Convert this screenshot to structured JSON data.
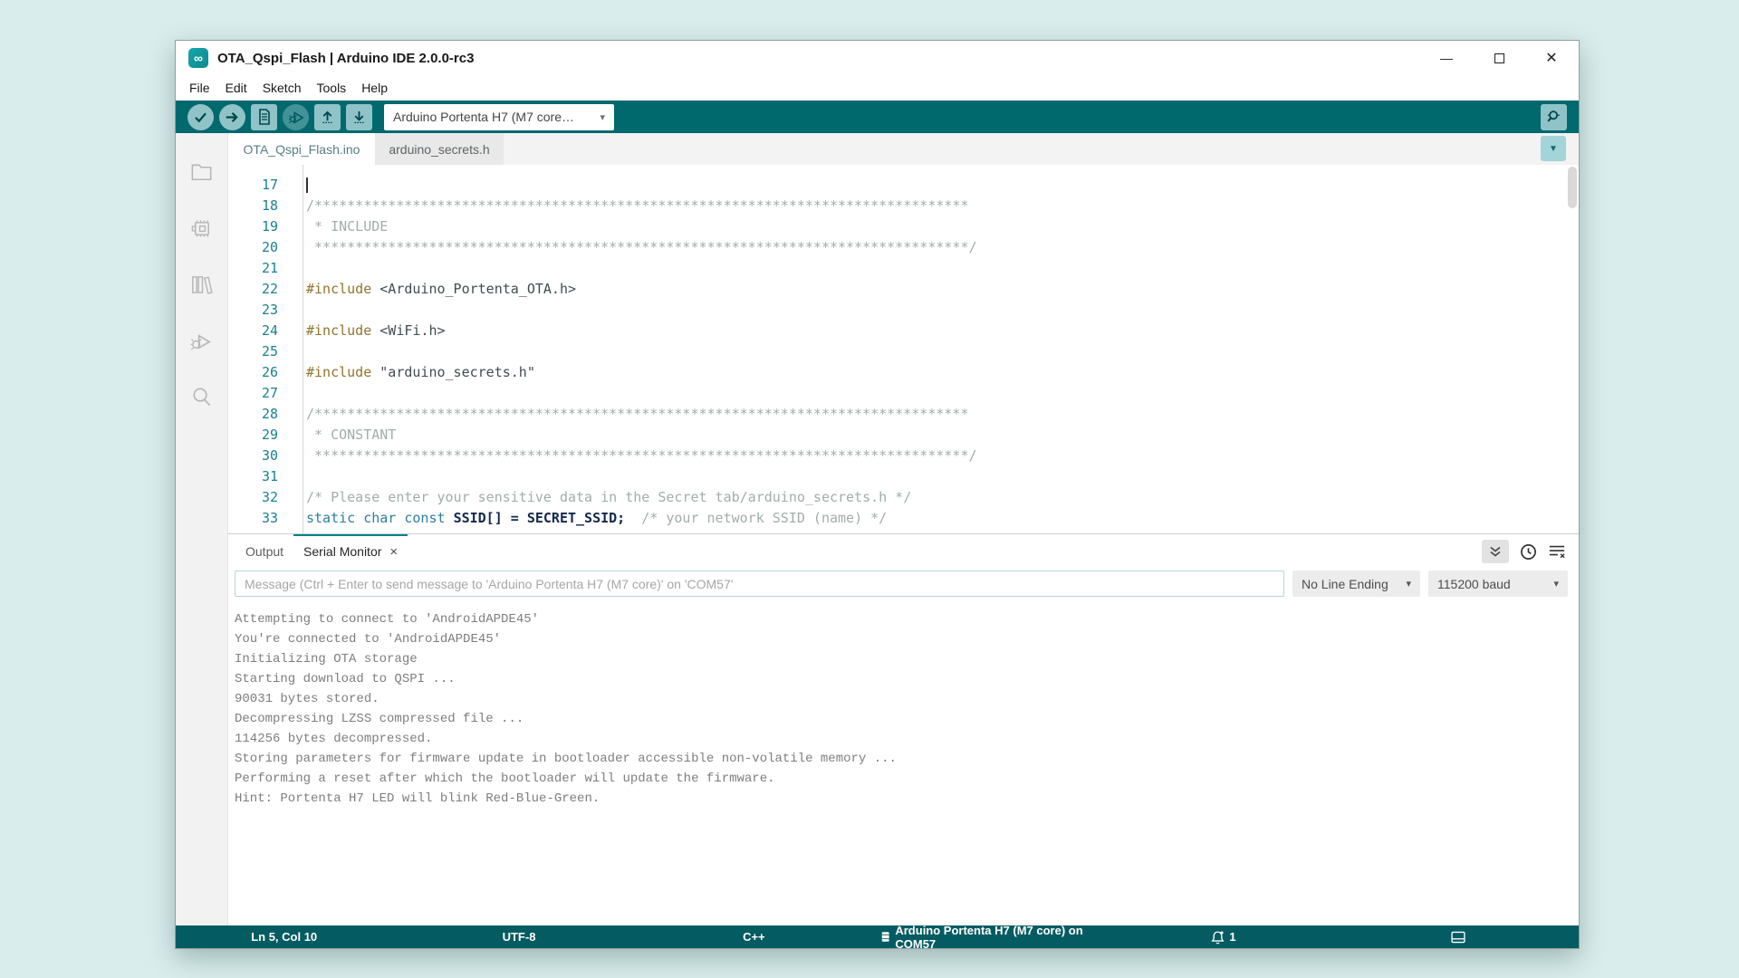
{
  "window": {
    "title": "OTA_Qspi_Flash | Arduino IDE 2.0.0-rc3"
  },
  "menu": {
    "items": [
      "File",
      "Edit",
      "Sketch",
      "Tools",
      "Help"
    ]
  },
  "toolbar": {
    "board_selector": "Arduino Portenta H7 (M7 core…"
  },
  "icons": {
    "toolbar": [
      "check",
      "arrow-right",
      "document",
      "bug-play",
      "arrow-up",
      "arrow-down",
      "caret-down",
      "magnifier"
    ],
    "sidebar": [
      "folder",
      "board-chip",
      "library-books",
      "debug-bug",
      "search-magnifier"
    ],
    "panel": [
      "collapse-double-chevron",
      "timestamp-clock",
      "clear-output"
    ],
    "status": [
      "board-chip",
      "notification-bell",
      "toggle-panel"
    ]
  },
  "colors": {
    "toolbar_teal": "#00696e",
    "status_teal": "#045c62",
    "button_teal": "#8fc3c7",
    "accent_teal": "#00838a",
    "page_background": "#d9edec"
  },
  "editor": {
    "tabs": [
      {
        "label": "OTA_Qspi_Flash.ino",
        "active": true
      },
      {
        "label": "arduino_secrets.h",
        "active": false
      }
    ],
    "lines": [
      {
        "n": 17,
        "cursor": true,
        "tokens": []
      },
      {
        "n": 18,
        "tokens": [
          {
            "t": "/********************************************************************************",
            "c": "comment"
          }
        ]
      },
      {
        "n": 19,
        "tokens": [
          {
            "t": " * INCLUDE",
            "c": "comment"
          }
        ]
      },
      {
        "n": 20,
        "tokens": [
          {
            "t": " ********************************************************************************/",
            "c": "comment"
          }
        ]
      },
      {
        "n": 21,
        "tokens": []
      },
      {
        "n": 22,
        "tokens": [
          {
            "t": "#include",
            "c": "directive"
          },
          {
            "t": " <Arduino_Portenta_OTA.h>",
            "c": "plain"
          }
        ]
      },
      {
        "n": 23,
        "tokens": []
      },
      {
        "n": 24,
        "tokens": [
          {
            "t": "#include",
            "c": "directive"
          },
          {
            "t": " <WiFi.h>",
            "c": "plain"
          }
        ]
      },
      {
        "n": 25,
        "tokens": []
      },
      {
        "n": 26,
        "tokens": [
          {
            "t": "#include",
            "c": "directive"
          },
          {
            "t": " \"arduino_secrets.h\"",
            "c": "plain"
          }
        ]
      },
      {
        "n": 27,
        "tokens": []
      },
      {
        "n": 28,
        "tokens": [
          {
            "t": "/********************************************************************************",
            "c": "comment"
          }
        ]
      },
      {
        "n": 29,
        "tokens": [
          {
            "t": " * CONSTANT",
            "c": "comment"
          }
        ]
      },
      {
        "n": 30,
        "tokens": [
          {
            "t": " ********************************************************************************/",
            "c": "comment"
          }
        ]
      },
      {
        "n": 31,
        "tokens": []
      },
      {
        "n": 32,
        "tokens": [
          {
            "t": "/* Please enter your sensitive data in the Secret tab/arduino_secrets.h */",
            "c": "comment"
          }
        ]
      },
      {
        "n": 33,
        "tokens": [
          {
            "t": "static char const ",
            "c": "keyword"
          },
          {
            "t": "SSID[] = SECRET_SSID;",
            "c": "bold"
          },
          {
            "t": "  /* your network SSID (name) */",
            "c": "comment"
          }
        ]
      }
    ]
  },
  "bottom_panel": {
    "tabs": [
      {
        "label": "Output",
        "active": false
      },
      {
        "label": "Serial Monitor",
        "active": true,
        "closable": true
      }
    ],
    "message_input_placeholder": "Message (Ctrl + Enter to send message to 'Arduino Portenta H7 (M7 core)' on 'COM57'",
    "line_ending": "No Line Ending",
    "baud_rate": "115200 baud",
    "output_lines": [
      "Attempting to connect to 'AndroidAPDE45'",
      "You're connected to 'AndroidAPDE45'",
      "Initializing OTA storage",
      "Starting download to QSPI ...",
      "90031 bytes stored.",
      "Decompressing LZSS compressed file ...",
      "114256 bytes decompressed.",
      "Storing parameters for firmware update in bootloader accessible non-volatile memory ...",
      "Performing a reset after which the bootloader will update the firmware.",
      "Hint: Portenta H7 LED will blink Red-Blue-Green."
    ]
  },
  "status_bar": {
    "position": "Ln 5, Col 10",
    "encoding": "UTF-8",
    "language": "C++",
    "board": "Arduino Portenta H7 (M7 core) on COM57",
    "notifications": "1"
  }
}
